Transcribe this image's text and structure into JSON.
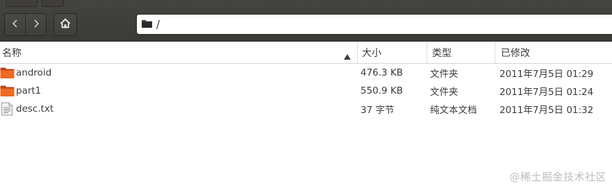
{
  "location": {
    "path": "/"
  },
  "columns": {
    "name": "名称",
    "size": "大小",
    "type": "类型",
    "modified": "已修改"
  },
  "files": [
    {
      "name": "android",
      "size": "476.3 KB",
      "type": "文件夹",
      "modified": "2011年7月5日 01:29",
      "icon": "folder-icon"
    },
    {
      "name": "part1",
      "size": "550.9 KB",
      "type": "文件夹",
      "modified": "2011年7月5日 01:24",
      "icon": "folder-icon"
    },
    {
      "name": "desc.txt",
      "size": "37 字节",
      "type": "纯文本文档",
      "modified": "2011年7月5日 01:32",
      "icon": "text-file-icon"
    }
  ],
  "watermark": "@稀土掘金技术社区",
  "colors": {
    "toolbar": "#3d3c39",
    "folder": "#e8641e",
    "text": "#3c3c3c"
  }
}
